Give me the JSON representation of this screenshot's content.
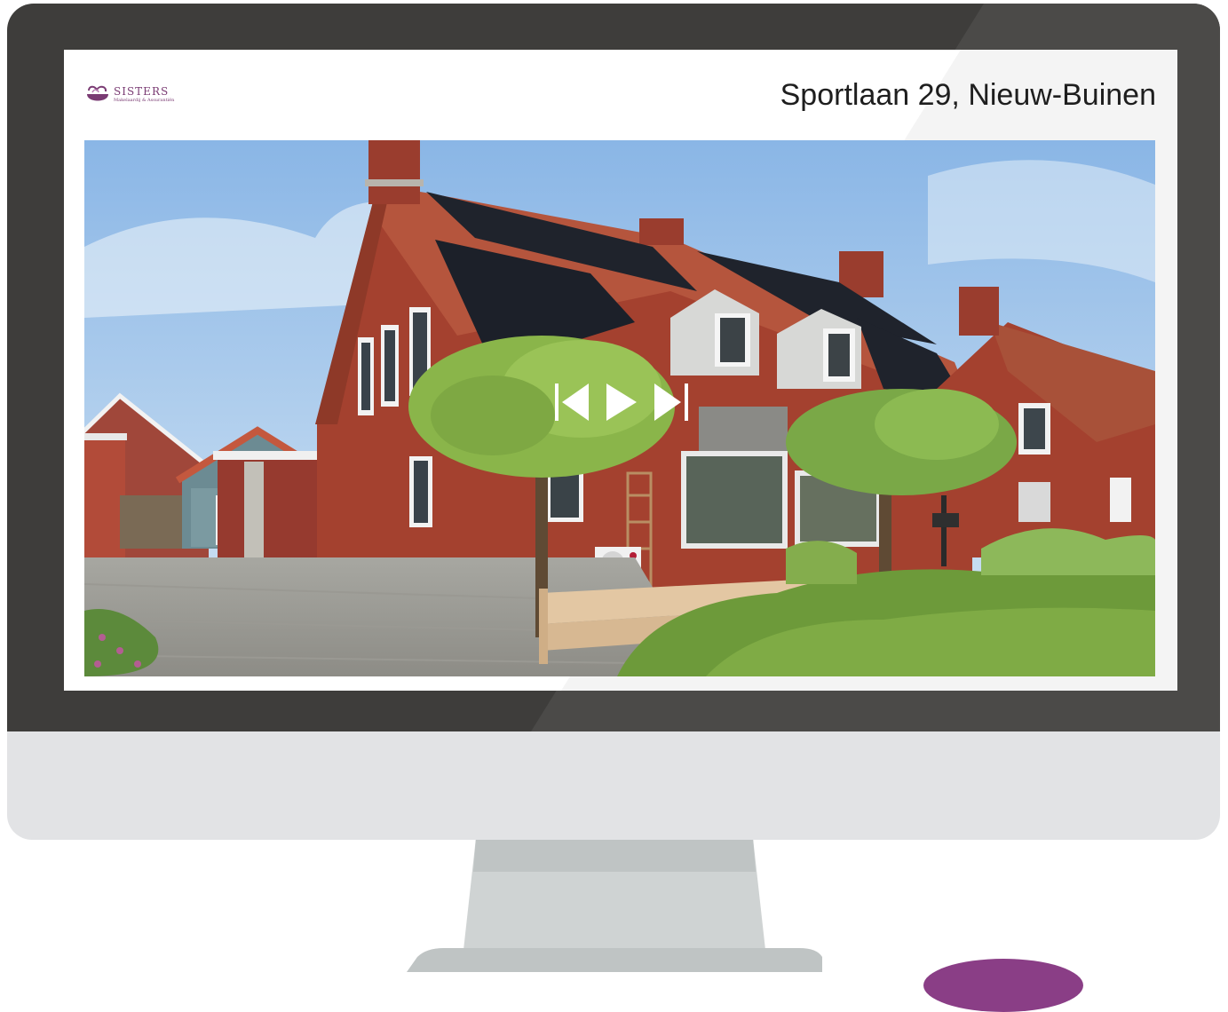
{
  "listing": {
    "address": "Sportlaan 29, Nieuw-Buinen"
  },
  "brand": {
    "name": "SISTERS",
    "tagline": "Makelaardij & Assurantiën",
    "color": "#7a3b73"
  },
  "slideshow": {
    "controls": [
      "skip-previous-icon",
      "play-icon",
      "skip-next-icon"
    ]
  },
  "colors": {
    "bezel": "#3e3d3b",
    "chin": "#e2e3e5",
    "stand": "#cfd3d3",
    "accent": "#8a3e86"
  }
}
